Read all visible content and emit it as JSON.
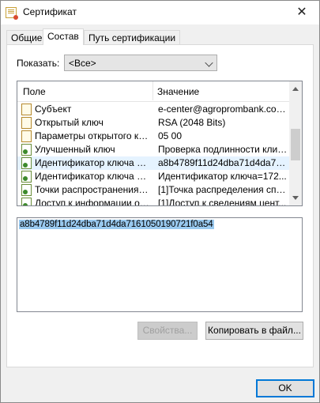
{
  "window": {
    "title": "Сертификат"
  },
  "tabs": [
    {
      "label": "Общие"
    },
    {
      "label": "Состав"
    },
    {
      "label": "Путь сертификации"
    }
  ],
  "filter": {
    "label": "Показать:",
    "selected": "<Все>"
  },
  "list": {
    "columns": [
      "Поле",
      "Значение"
    ],
    "rows": [
      {
        "field": "Субъект",
        "value": "e-center@agroprombank.com,...",
        "icon": "certificate-field-icon"
      },
      {
        "field": "Открытый ключ",
        "value": "RSA (2048 Bits)",
        "icon": "certificate-field-icon"
      },
      {
        "field": "Параметры открытого кл...",
        "value": "05 00",
        "icon": "certificate-field-icon"
      },
      {
        "field": "Улучшенный ключ",
        "value": "Проверка подлинности клие...",
        "icon": "extension-field-icon"
      },
      {
        "field": "Идентификатор ключа су...",
        "value": "a8b4789f11d24dba71d4da71...",
        "icon": "extension-field-icon",
        "selected": true
      },
      {
        "field": "Идентификатор ключа це...",
        "value": "Идентификатор ключа=172...",
        "icon": "extension-field-icon"
      },
      {
        "field": "Точки распространения сп...",
        "value": "[1]Точка распределения спи...",
        "icon": "extension-field-icon"
      },
      {
        "field": "Доступ к информации о це...",
        "value": "[1]Доступ к сведениям цент...",
        "icon": "extension-field-icon"
      }
    ]
  },
  "detail": {
    "value": "a8b4789f11d24dba71d4da7161050190721f0a54"
  },
  "buttons": {
    "properties": "Свойства...",
    "copy_to_file": "Копировать в файл...",
    "ok": "OK"
  }
}
